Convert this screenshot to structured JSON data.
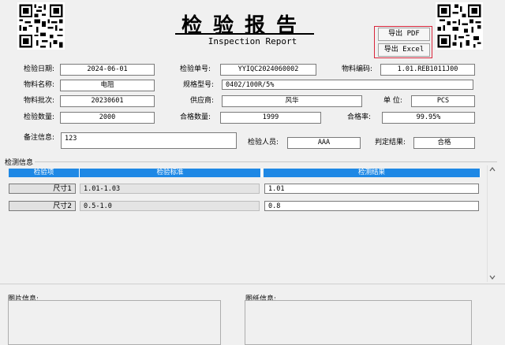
{
  "header": {
    "title": "检验报告",
    "subtitle": "Inspection Report",
    "export_pdf": "导出 PDF",
    "export_excel": "导出 Excel"
  },
  "form": {
    "inspect_date": {
      "label": "检验日期:",
      "value": "2024-06-01"
    },
    "inspect_no": {
      "label": "检验单号:",
      "value": "YYIQC2024060002"
    },
    "material_code": {
      "label": "物料编码:",
      "value": "1.01.REB1011J00"
    },
    "material_name": {
      "label": "物料名称:",
      "value": "电阻"
    },
    "spec_model": {
      "label": "规格型号:",
      "value": "0402/100R/5%"
    },
    "material_batch": {
      "label": "物料批次:",
      "value": "20230601"
    },
    "supplier": {
      "label": "供应商:",
      "value": "风华"
    },
    "unit": {
      "label": "单 位:",
      "value": "PCS"
    },
    "inspect_qty": {
      "label": "检验数量:",
      "value": "2000"
    },
    "pass_qty": {
      "label": "合格数量:",
      "value": "1999"
    },
    "pass_rate": {
      "label": "合格率:",
      "value": "99.95%"
    },
    "remarks": {
      "label": "备注信息:",
      "value": "123"
    },
    "inspector": {
      "label": "检验人员:",
      "value": "AAA"
    },
    "verdict": {
      "label": "判定结果:",
      "value": "合格"
    }
  },
  "detection": {
    "section_label": "检测信息",
    "columns": [
      "检验项",
      "检验标准",
      "检测结果"
    ],
    "rows": [
      {
        "item": "尺寸1",
        "standard": "1.01-1.03",
        "result": "1.01"
      },
      {
        "item": "尺寸2",
        "standard": "0.5-1.0",
        "result": "0.8"
      }
    ]
  },
  "images": {
    "label": "图片信息:"
  },
  "drawings": {
    "label": "图纸信息:"
  },
  "icons": {
    "qr_left": "qr-code-icon",
    "qr_right": "qr-code-icon",
    "scroll_up": "scroll-up-arrow-icon",
    "scroll_down": "scroll-down-arrow-icon"
  },
  "colors": {
    "header_blue": "#1e88e5",
    "highlight_red": "#d9263b"
  }
}
